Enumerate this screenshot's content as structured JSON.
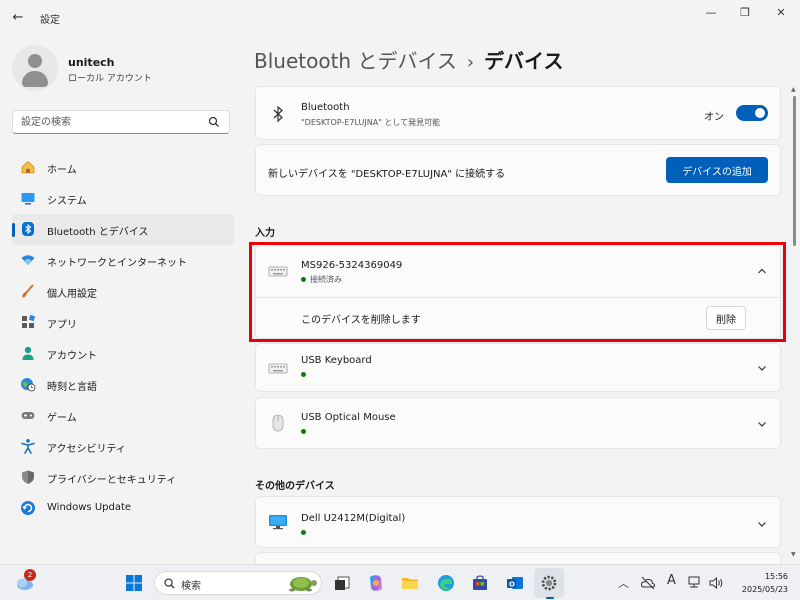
{
  "window": {
    "title": "設定",
    "back_glyph": "←",
    "min_glyph": "—",
    "max_glyph": "❐",
    "close_glyph": "✕"
  },
  "profile": {
    "name": "unitech",
    "account_type": "ローカル アカウント"
  },
  "search": {
    "placeholder": "設定の検索"
  },
  "sidebar": {
    "items": [
      {
        "label": "ホーム",
        "icon": "home-icon"
      },
      {
        "label": "システム",
        "icon": "system-icon"
      },
      {
        "label": "Bluetooth とデバイス",
        "icon": "bluetooth-icon",
        "selected": true
      },
      {
        "label": "ネットワークとインターネット",
        "icon": "wifi-icon"
      },
      {
        "label": "個人用設定",
        "icon": "brush-icon"
      },
      {
        "label": "アプリ",
        "icon": "apps-icon"
      },
      {
        "label": "アカウント",
        "icon": "account-icon"
      },
      {
        "label": "時刻と言語",
        "icon": "globe-clock-icon"
      },
      {
        "label": "ゲーム",
        "icon": "gamepad-icon"
      },
      {
        "label": "アクセシビリティ",
        "icon": "accessibility-icon"
      },
      {
        "label": "プライバシーとセキュリティ",
        "icon": "shield-icon"
      },
      {
        "label": "Windows Update",
        "icon": "update-icon"
      }
    ]
  },
  "breadcrumb": {
    "parent": "Bluetooth とデバイス",
    "separator": "›",
    "current": "デバイス"
  },
  "bluetooth_card": {
    "title": "Bluetooth",
    "subtitle": "\"DESKTOP-E7LUJNA\" として発見可能",
    "toggle_label": "オン",
    "toggle_on": true
  },
  "add_device_card": {
    "text": "新しいデバイスを \"DESKTOP-E7LUJNA\" に接続する",
    "button": "デバイスの追加"
  },
  "input_section": {
    "title": "入力",
    "devices": [
      {
        "name": "MS926-5324369049",
        "status": "接続済み",
        "icon": "keyboard-icon",
        "expanded": true,
        "remove_text": "このデバイスを削除します",
        "remove_button": "削除"
      },
      {
        "name": "USB Keyboard",
        "status": "",
        "icon": "keyboard-icon"
      },
      {
        "name": "USB Optical Mouse",
        "status": "",
        "icon": "mouse-icon"
      }
    ]
  },
  "other_section": {
    "title": "その他のデバイス",
    "devices": [
      {
        "name": "Dell U2412M(Digital)",
        "status": "",
        "icon": "monitor-icon"
      }
    ]
  },
  "taskbar": {
    "search_text": "検索",
    "weather_badge": "2",
    "language_indicator": "A",
    "time": "15:56",
    "date": "2025/05/23"
  },
  "colors": {
    "accent": "#005fb8",
    "highlight": "#e8000b",
    "connected": "#0f7b0f"
  }
}
